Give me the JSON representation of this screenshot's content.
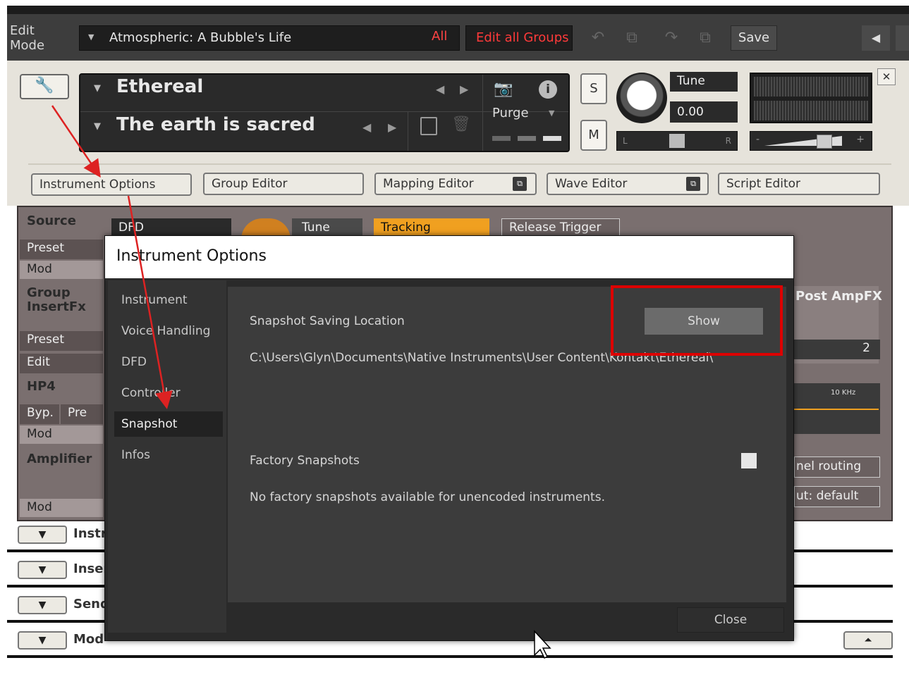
{
  "topbar": {
    "mode_label": "Edit\nMode",
    "instrument_name": "Atmospheric: A Bubble's Life",
    "all_label": "All",
    "edit_groups_label": "Edit all Groups",
    "save_label": "Save"
  },
  "instrument": {
    "name": "Ethereal",
    "snapshot": "The earth is sacred",
    "purge_label": "Purge",
    "solo_label": "S",
    "mute_label": "M",
    "tune_label": "Tune",
    "tune_value": "0.00",
    "pan_left": "L",
    "pan_right": "R",
    "vol_minus": "-",
    "vol_plus": "+"
  },
  "editor_tabs": [
    {
      "label": "Instrument Options"
    },
    {
      "label": "Group Editor"
    },
    {
      "label": "Mapping Editor"
    },
    {
      "label": "Wave Editor"
    },
    {
      "label": "Script Editor"
    }
  ],
  "rack": {
    "source": "Source",
    "dfd": "DFD",
    "tune": "Tune",
    "tracking": "Tracking",
    "release_trigger": "Release Trigger",
    "preset": "Preset",
    "mod": "Mod",
    "group_insert_fx": "Group\nInsertFx",
    "post_amp_fx": "Post AmpFX",
    "preset2": "Preset",
    "edit": "Edit",
    "value_2": "2",
    "hp4": "HP4",
    "byp": "Byp.",
    "pre": "Pre",
    "freq_label": "10 KHz",
    "amplifier": "Amplifier",
    "channel_routing": "nel routing",
    "output_default": "ut: default",
    "collapsed": [
      {
        "label": "Instr"
      },
      {
        "label": "Inser"
      },
      {
        "label": "Send"
      },
      {
        "label": "Mod"
      }
    ]
  },
  "dialog": {
    "title": "Instrument Options",
    "sidebar": [
      {
        "label": "Instrument"
      },
      {
        "label": "Voice Handling"
      },
      {
        "label": "DFD"
      },
      {
        "label": "Controller"
      },
      {
        "label": "Snapshot"
      },
      {
        "label": "Infos"
      }
    ],
    "selected_index": 4,
    "snapshot_location_label": "Snapshot Saving Location",
    "show_label": "Show",
    "path": "C:\\Users\\Glyn\\Documents\\Native Instruments\\User Content\\Kontakt\\Ethereal\\",
    "factory_label": "Factory Snapshots",
    "factory_checked": false,
    "factory_note": "No factory snapshots available for unencoded instruments.",
    "close_label": "Close"
  },
  "colors": {
    "annotation_red": "#dd2222",
    "error_red": "#ff3a3a",
    "tracking_orange": "#f0a020"
  }
}
